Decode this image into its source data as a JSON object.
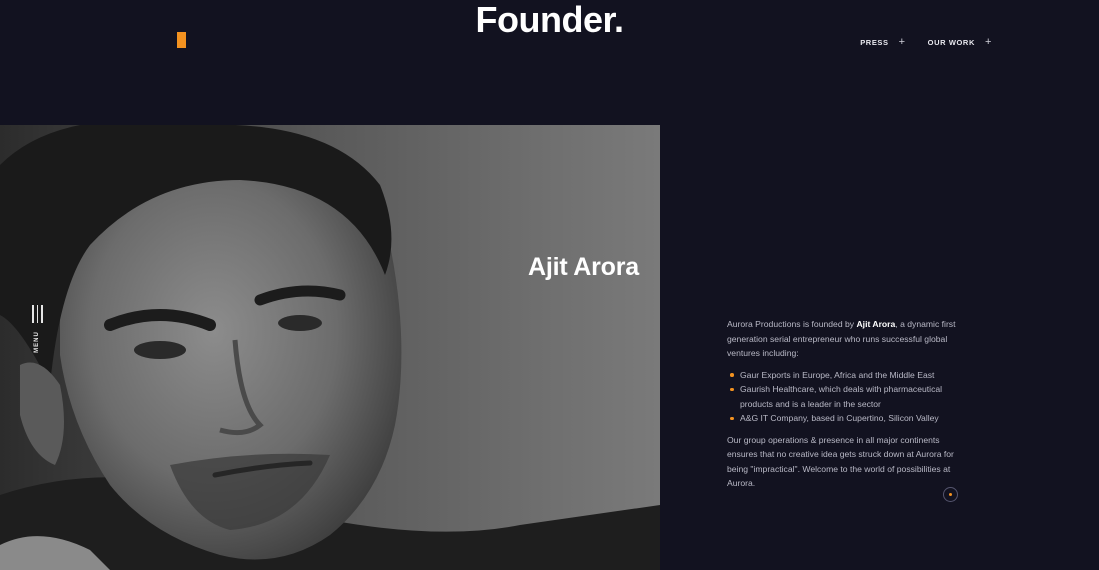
{
  "header": {
    "title": "Founder.",
    "nav": [
      {
        "label": "PRESS",
        "icon": "plus-icon"
      },
      {
        "label": "OUR WORK",
        "icon": "plus-icon"
      }
    ]
  },
  "hero": {
    "name": "Ajit Arora",
    "photo": "founder-portrait"
  },
  "menu": {
    "label": "MENU"
  },
  "about": {
    "intro_prefix": "Aurora Productions is founded by ",
    "intro_name": "Ajit Arora",
    "intro_suffix": ", a dynamic first generation serial entrepreneur who runs successful global ventures including:",
    "ventures": [
      "Gaur Exports in Europe, Africa and the Middle East",
      "Gaurish Healthcare, which deals with pharmaceutical products and is a leader in the sector",
      "A&G IT Company, based in Cupertino, Silicon Valley"
    ],
    "closing": "Our group operations & presence in all major continents ensures that no creative idea gets struck down at Aurora for being \"impractical\". Welcome to the world of possibilities at Aurora."
  },
  "colors": {
    "background": "#121220",
    "accent": "#f39220"
  }
}
